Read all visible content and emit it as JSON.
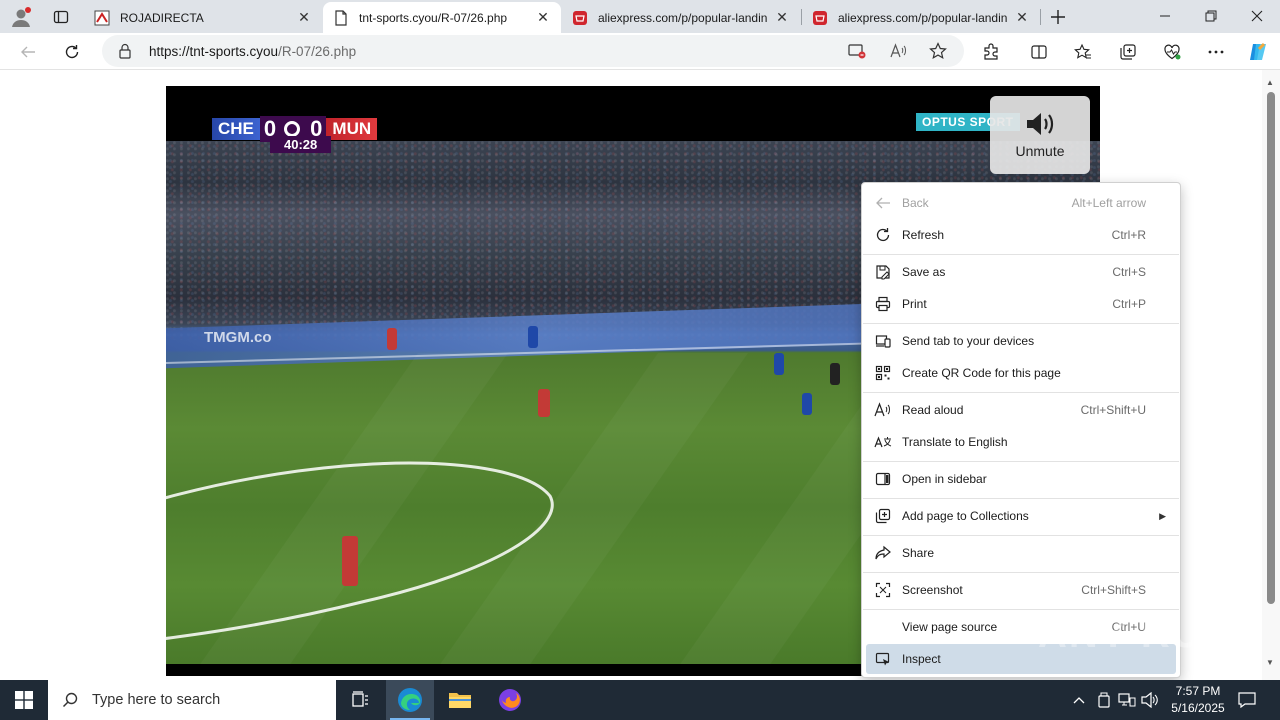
{
  "browser": {
    "tabs": [
      {
        "title": "ROJADIRECTA",
        "favicon": "rojadirecta-favicon",
        "active": false
      },
      {
        "title": "tnt-sports.cyou/R-07/26.php",
        "favicon": "page-icon",
        "active": true
      },
      {
        "title": "aliexpress.com/p/popular-landin",
        "favicon": "aliexpress-favicon",
        "active": false
      },
      {
        "title": "aliexpress.com/p/popular-landin",
        "favicon": "aliexpress-favicon",
        "active": false
      }
    ],
    "address": {
      "host": "https://tnt-sports.cyou",
      "path": "/R-07/26.php"
    }
  },
  "video": {
    "scoreboard": {
      "home": "CHE",
      "home_score": "0",
      "away_score": "0",
      "away": "MUN",
      "clock": "40:28"
    },
    "broadcaster": "OPTUS SPORT",
    "board_text": "TMGM.co",
    "unmute_label": "Unmute"
  },
  "context_menu": {
    "items": [
      {
        "label": "Back",
        "shortcut": "Alt+Left arrow",
        "icon": "back-arrow-icon",
        "disabled": true
      },
      {
        "label": "Refresh",
        "shortcut": "Ctrl+R",
        "icon": "refresh-icon"
      },
      {
        "label": "Save as",
        "shortcut": "Ctrl+S",
        "icon": "save-as-icon"
      },
      {
        "label": "Print",
        "shortcut": "Ctrl+P",
        "icon": "print-icon"
      },
      {
        "label": "Send tab to your devices",
        "shortcut": "",
        "icon": "send-tab-icon"
      },
      {
        "label": "Create QR Code for this page",
        "shortcut": "",
        "icon": "qr-code-icon"
      },
      {
        "label": "Read aloud",
        "shortcut": "Ctrl+Shift+U",
        "icon": "read-aloud-icon"
      },
      {
        "label": "Translate to English",
        "shortcut": "",
        "icon": "translate-icon"
      },
      {
        "label": "Open in sidebar",
        "shortcut": "",
        "icon": "sidebar-icon"
      },
      {
        "label": "Add page to Collections",
        "shortcut": "",
        "icon": "collections-icon",
        "submenu": true
      },
      {
        "label": "Share",
        "shortcut": "",
        "icon": "share-icon"
      },
      {
        "label": "Screenshot",
        "shortcut": "Ctrl+Shift+S",
        "icon": "screenshot-icon"
      },
      {
        "label": "View page source",
        "shortcut": "Ctrl+U",
        "icon": ""
      },
      {
        "label": "Inspect",
        "shortcut": "",
        "icon": "inspect-icon",
        "hover": true
      }
    ]
  },
  "watermark": "ANY RUN",
  "taskbar": {
    "search_placeholder": "Type here to search",
    "time": "7:57 PM",
    "date": "5/16/2025"
  },
  "colors": {
    "tabstrip": "#dfe3e8",
    "accent": "#0067c0",
    "menu_hover": "#cfdce8",
    "taskbar": "#1f2a36"
  }
}
